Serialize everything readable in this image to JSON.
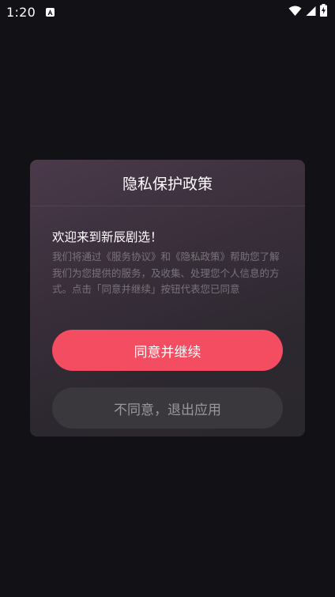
{
  "status_bar": {
    "time": "1:20",
    "notification_icon": "a-letter-icon",
    "icons": [
      "wifi-icon",
      "signal-icon",
      "battery-charging-icon"
    ]
  },
  "dialog": {
    "title": "隐私保护政策",
    "welcome": "欢迎来到新辰剧选！",
    "body_prefix": "我们将通过",
    "service_agreement": "《服务协议》",
    "and": "和",
    "privacy_policy": "《隐私政策》",
    "body_suffix": "帮助您了解我们为您提供的服务，及收集、处理您个人信息的方式。点击「同意并继续」按钮代表您已同意",
    "agree_button": "同意并继续",
    "disagree_button": "不同意，退出应用"
  },
  "colors": {
    "background": "#121116",
    "accent": "#f44d62",
    "secondary_button": "#3a383d"
  }
}
